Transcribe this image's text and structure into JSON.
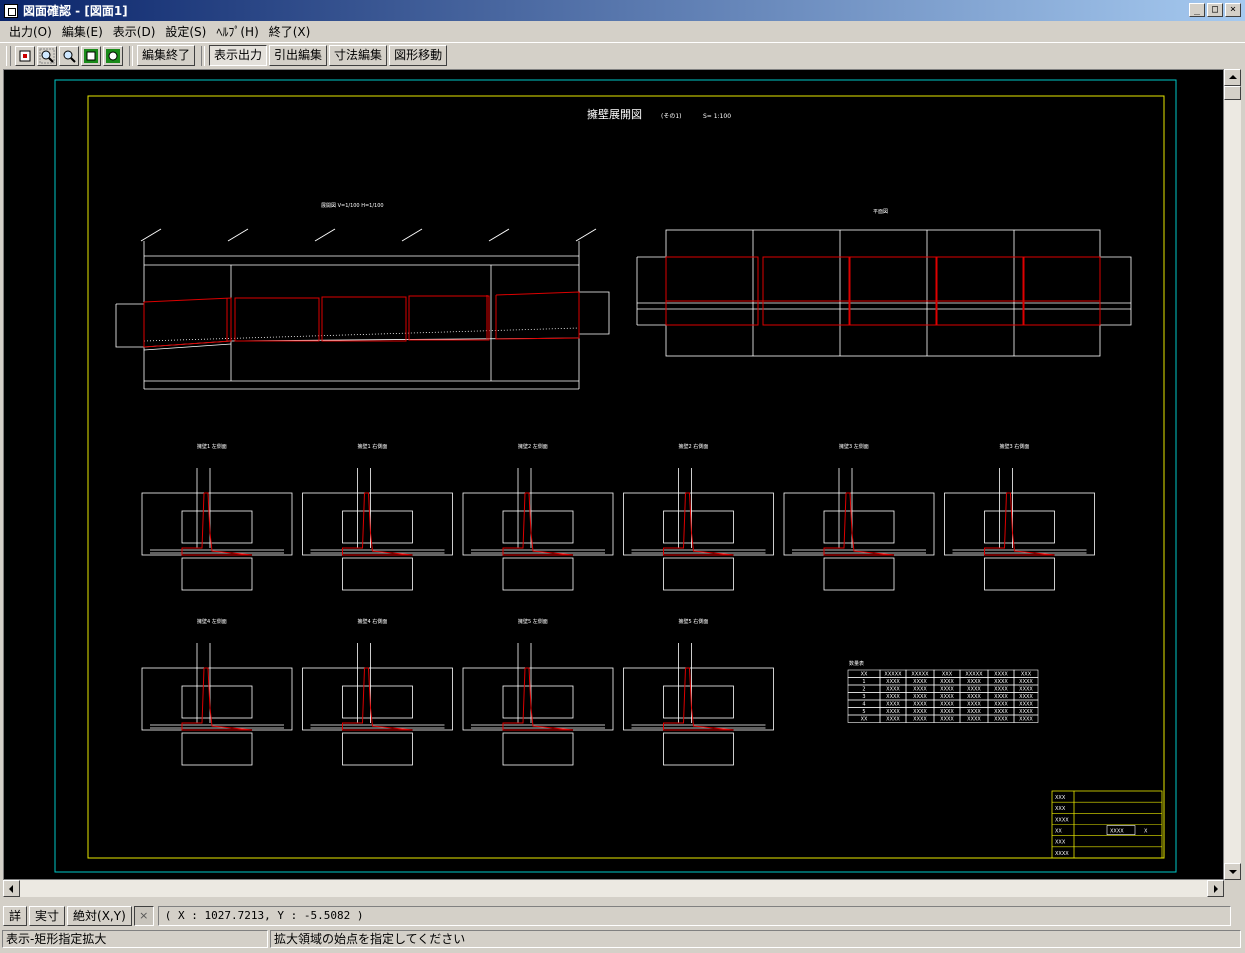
{
  "window": {
    "title": "図面確認 - [図面1]",
    "min_glyph": "_",
    "max_glyph": "□",
    "close_glyph": "×"
  },
  "menu": [
    "出力(O)",
    "編集(E)",
    "表示(D)",
    "設定(S)",
    "ﾍﾙﾌﾟ(H)",
    "終了(X)"
  ],
  "toolbar": {
    "edit_end": "編集終了",
    "display_output": "表示出力",
    "leader_edit": "引出編集",
    "dimension_edit": "寸法編集",
    "shape_move": "図形移動"
  },
  "drawing": {
    "title": "擁壁展開図",
    "title_sub": "(その1)",
    "scale": "S=   1:100",
    "elevation_label": "展開図  V=1/100  H=1/100",
    "plan_label": "平面図",
    "sections_row1": [
      "擁壁1 左側面",
      "擁壁1 右側面",
      "擁壁2 左側面",
      "擁壁2 右側面",
      "擁壁3 左側面",
      "擁壁3 右側面"
    ],
    "sections_row2": [
      "擁壁4 左側面",
      "擁壁4 右側面",
      "擁壁5 左側面",
      "擁壁5 右側面"
    ],
    "table_title": "数量表",
    "table_rows": [
      [
        "XX",
        "XXXXX",
        "XXXXX",
        "XXX",
        "XXXXX",
        "XXXX",
        "XXX"
      ],
      [
        "1",
        "XXXX",
        "XXXX",
        "XXXX",
        "XXXX",
        "XXXX",
        "XXXX"
      ],
      [
        "2",
        "XXXX",
        "XXXX",
        "XXXX",
        "XXXX",
        "XXXX",
        "XXXX"
      ],
      [
        "3",
        "XXXX",
        "XXXX",
        "XXXX",
        "XXXX",
        "XXXX",
        "XXXX"
      ],
      [
        "4",
        "XXXX",
        "XXXX",
        "XXXX",
        "XXXX",
        "XXXX",
        "XXXX"
      ],
      [
        "5",
        "XXXX",
        "XXXX",
        "XXXX",
        "XXXX",
        "XXXX",
        "XXXX"
      ],
      [
        "XX",
        "XXXX",
        "XXXX",
        "XXXX",
        "XXXX",
        "XXXX",
        "XXXX"
      ]
    ],
    "titleblock": [
      "XXX",
      "XXX",
      "XXXX",
      "XX",
      "XXX",
      "XXXX"
    ],
    "titleblock_val1": "XXXX",
    "titleblock_val2": "X"
  },
  "coord": {
    "detail": "詳",
    "actual": "実寸",
    "absolute": "絶対(X,Y)",
    "x_glyph": "×",
    "readout": "( X : 1027.7213, Y : -5.5082 )"
  },
  "status": {
    "mode": "表示-矩形指定拡大",
    "message": "拡大領域の始点を指定してください"
  },
  "colors": {
    "canvas": "#000000",
    "outer_frame": "#00c8c8",
    "inner_frame": "#e8e800",
    "line": "#ffffff",
    "wall": "#dd0000"
  }
}
